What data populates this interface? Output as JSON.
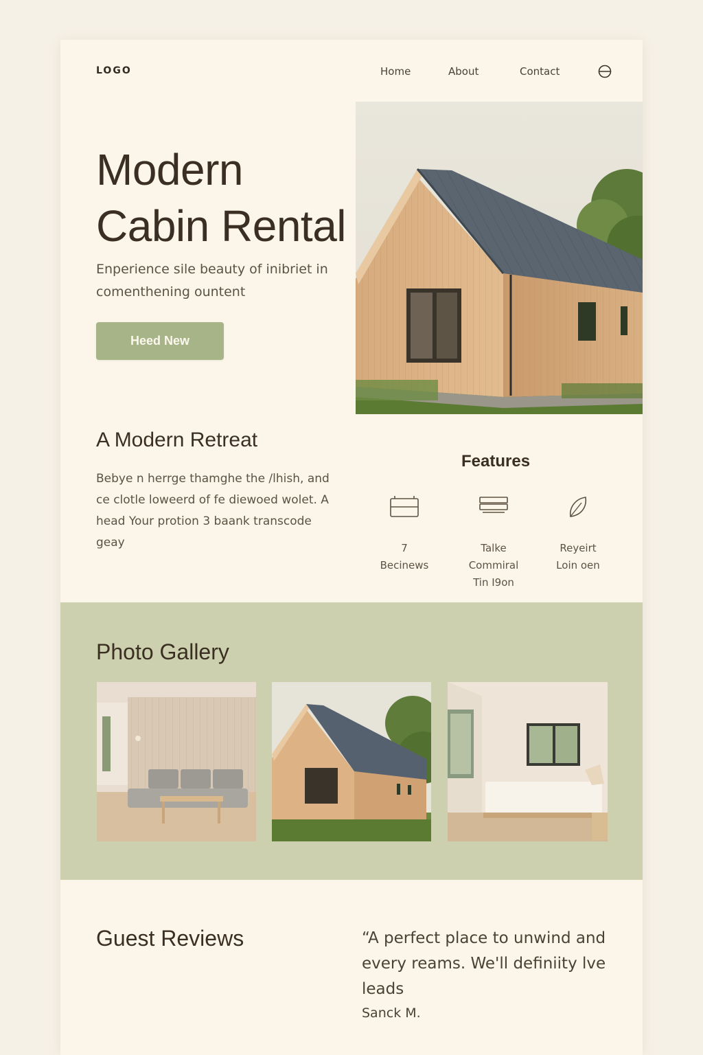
{
  "nav": {
    "logo": "LOGO",
    "links": [
      "Home",
      "About",
      "Contact"
    ],
    "icon": "globe-icon"
  },
  "hero": {
    "title_line1": "Modern",
    "title_line2": "Cabin Rental",
    "subtitle": "Enperience sile beauty of inibriet in comenthening ountent",
    "button": "Heed New"
  },
  "retreat": {
    "title": "A Modern Retreat",
    "body": "Bebye n herrge thamghe the /lhish, and ce clotle loweerd of fe diewoed wolet. A head Your protion 3 baank transcode geay"
  },
  "features": {
    "title": "Features",
    "items": [
      {
        "icon": "bed-icon",
        "label": "7\nBecinews"
      },
      {
        "icon": "stack-icon",
        "label": "Talke\nCommiral\nTin I9on"
      },
      {
        "icon": "leaf-icon",
        "label": "Reyeirt\nLoin oen"
      }
    ]
  },
  "gallery": {
    "title": "Photo Gallery",
    "photos": [
      "living-room-photo",
      "cabin-exterior-photo",
      "bedroom-photo"
    ]
  },
  "reviews": {
    "title": "Guest Reviews",
    "quote": "“A perfect place to unwind and every reams. We'll definiity lve leads",
    "author": "Sanck M."
  },
  "colors": {
    "page_bg": "#f6f1e6",
    "card_bg": "#fbf6e9",
    "accent_green": "#a7b488",
    "gallery_bg": "#ccd0ae",
    "text_dark": "#3a2f22"
  }
}
